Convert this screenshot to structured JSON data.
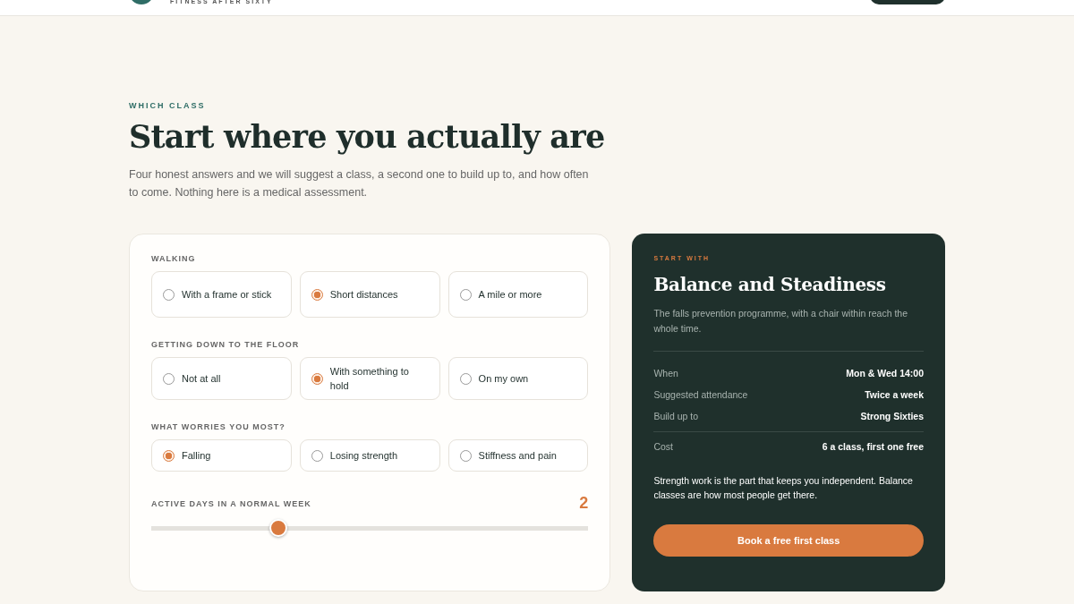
{
  "header": {
    "tagline": "FITNESS AFTER SIXTY"
  },
  "intro": {
    "eyebrow": "WHICH CLASS",
    "title": "Start where you actually are",
    "text": "Four honest answers and we will suggest a class, a second one to build up to, and how often to come. Nothing here is a medical assessment."
  },
  "questions": [
    {
      "label": "WALKING",
      "options": [
        {
          "label": "With a frame or stick",
          "selected": false
        },
        {
          "label": "Short distances",
          "selected": true
        },
        {
          "label": "A mile or more",
          "selected": false
        }
      ]
    },
    {
      "label": "GETTING DOWN TO THE FLOOR",
      "options": [
        {
          "label": "Not at all",
          "selected": false
        },
        {
          "label": "With something to hold",
          "selected": true
        },
        {
          "label": "On my own",
          "selected": false
        }
      ]
    },
    {
      "label": "WHAT WORRIES YOU MOST?",
      "options": [
        {
          "label": "Falling",
          "selected": true
        },
        {
          "label": "Losing strength",
          "selected": false
        },
        {
          "label": "Stiffness and pain",
          "selected": false
        }
      ]
    }
  ],
  "active_days": {
    "label": "ACTIVE DAYS IN A NORMAL WEEK",
    "reading": "2",
    "level": 0.29
  },
  "result": {
    "eyebrow": "START WITH",
    "title": "Balance and Steadiness",
    "description": "The falls prevention programme, with a chair within reach the whole time.",
    "details": [
      {
        "label": "When",
        "value": "Mon & Wed 14:00"
      },
      {
        "label": "Suggested attendance",
        "value": "Twice a week"
      },
      {
        "label": "Build up to",
        "value": "Strong Sixties"
      }
    ],
    "cost": {
      "label": "Cost",
      "value": "6 a class, first one free"
    },
    "note": "Strength work is the part that keeps you independent. Balance classes are how most people get there.",
    "button": "Book a free first class"
  }
}
